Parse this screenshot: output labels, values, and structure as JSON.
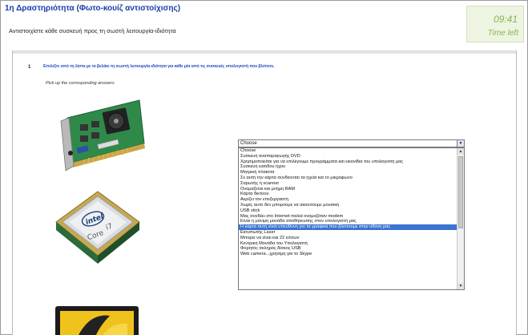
{
  "header": {
    "title": "1η Δραστηριότητα (Φωτο-κουίζ αντιστοίχισης)",
    "subtitle": "Αντιστοιχίστε κάθε συσκευή προς τη σωστή λειτουργία-ιδιότητα"
  },
  "timer": {
    "time": "09:41",
    "label": "Time left"
  },
  "question": {
    "number": "1",
    "instruction": "Επιλέξτε από τη λίστα με το βελάκι τη σωστή λειτουργία-ιδιότητα για κάθε μία από τις συσκευές υπολογιστή που βλέπετε.",
    "pickup": "Pick up the corresponding answers"
  },
  "select": {
    "value": "Choose",
    "options": [
      "Choose",
      "Συσκευή αναπαραγωγής DVD",
      "Χρησιμοποιείται για να επιλέγουμε προγράμματα και εικονίδια του υπολογιστή μας",
      "Συσκευή εισόδου ήχου",
      "Μητρική πλακέτα",
      "Σε αυτή την κάρτα συνδέονται τα ηχεία και το μικρόφωνο",
      "Σαρωτής ή scanner",
      "Ονομάζεται και μνήμη RAM",
      "Κάρτα δικτύου",
      "Αερίζει τον επεξεργαστή",
      "Χωρίς αυτό δεν μπορούμε να ακούσουμε μουσική",
      "USB stick",
      "Μας συνδέει στο Internet-παλιά ονομαζόταν modem",
      "Είναι η μόνιμη μονάδα αποθήκευσης στον υπολογιστή μας",
      "Η κάρτα αυτή είναι υπεύθυνη για τα γραφικά που βλέπουμε στην οθόνη μας",
      "Εκτυπωτής Laser",
      "Μπορεί να είναι και 22 ιντσών",
      "Κεντρική Μονάδα του Υπολογιστή",
      "Φορητός σκληρός δίσκος USB",
      "Web camera...χρήσιμη για το Skype"
    ],
    "selected_index": 14
  },
  "images": {
    "cpu_brand": "intel",
    "cpu_model": "Core",
    "cpu_suffix": "i7"
  },
  "colors": {
    "title": "#1a3ea8",
    "timer_text": "#8ab354",
    "timer_bg": "#eef4e2",
    "selection": "#3b73d1"
  }
}
